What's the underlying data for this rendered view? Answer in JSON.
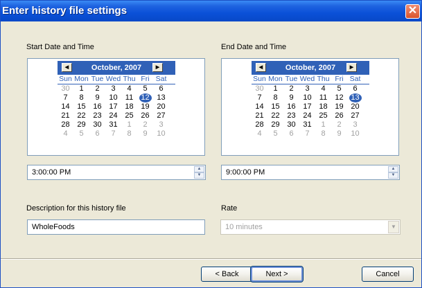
{
  "window": {
    "title": "Enter history file settings",
    "close_glyph": "✕"
  },
  "start": {
    "label": "Start Date and Time",
    "month_label": "October, 2007",
    "prev_glyph": "◀",
    "next_glyph": "▶",
    "time": "3:00:00 PM",
    "selected_day": "12"
  },
  "end": {
    "label": "End Date and Time",
    "month_label": "October, 2007",
    "prev_glyph": "◀",
    "next_glyph": "▶",
    "time": "9:00:00 PM",
    "selected_day": "13"
  },
  "calendar": {
    "days_of_week": [
      "Sun",
      "Mon",
      "Tue",
      "Wed",
      "Thu",
      "Fri",
      "Sat"
    ],
    "weeks": [
      [
        "30",
        "1",
        "2",
        "3",
        "4",
        "5",
        "6"
      ],
      [
        "7",
        "8",
        "9",
        "10",
        "11",
        "12",
        "13"
      ],
      [
        "14",
        "15",
        "16",
        "17",
        "18",
        "19",
        "20"
      ],
      [
        "21",
        "22",
        "23",
        "24",
        "25",
        "26",
        "27"
      ],
      [
        "28",
        "29",
        "30",
        "31",
        "1",
        "2",
        "3"
      ],
      [
        "4",
        "5",
        "6",
        "7",
        "8",
        "9",
        "10"
      ]
    ]
  },
  "description": {
    "label": "Description for this history file",
    "value": "WholeFoods"
  },
  "rate": {
    "label": "Rate",
    "value": "10 minutes",
    "disabled": true
  },
  "buttons": {
    "back": "< Back",
    "next": "Next >",
    "cancel": "Cancel"
  },
  "colors": {
    "titlebar": "#0a50d8",
    "calendar_accent": "#3061b7",
    "dialog_bg": "#ece9d8"
  }
}
